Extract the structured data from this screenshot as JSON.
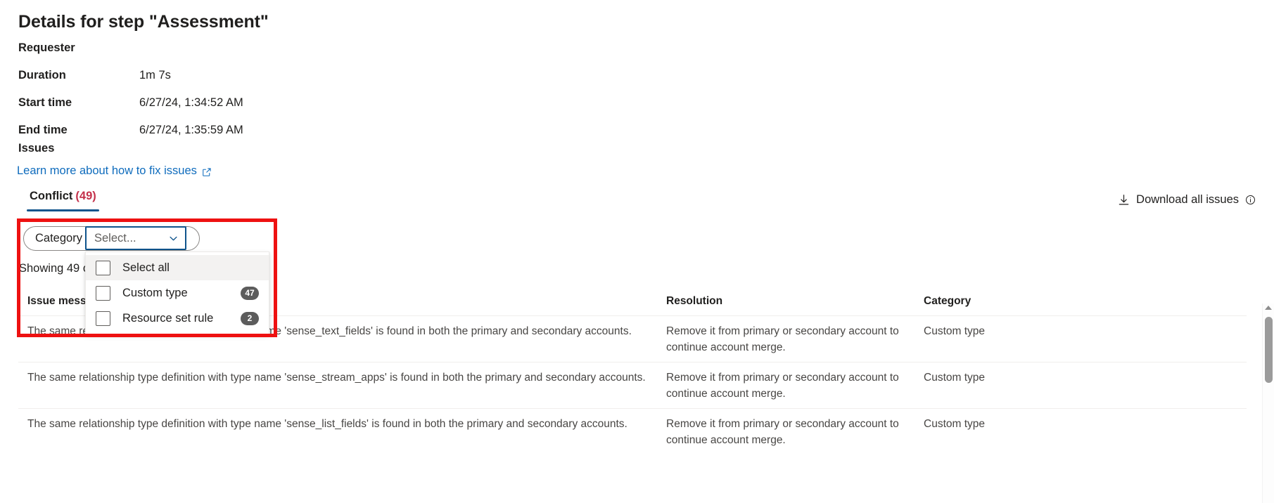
{
  "header": {
    "title": "Details for step \"Assessment\"",
    "meta": [
      {
        "label": "Requester",
        "value": ""
      },
      {
        "label": "Duration",
        "value": "1m 7s"
      },
      {
        "label": "Start time",
        "value": "6/27/24, 1:34:52 AM"
      },
      {
        "label": "End time",
        "value": "6/27/24, 1:35:59 AM"
      }
    ],
    "issues_heading": "Issues",
    "learn_link": "Learn more about how to fix issues",
    "learn_link_icon": "external-link-icon"
  },
  "tabs": [
    {
      "label": "Conflict",
      "count": "(49)",
      "selected": true
    }
  ],
  "download": {
    "label": "Download all issues",
    "download_icon": "download-icon",
    "info_icon": "info-circle-icon"
  },
  "filter": {
    "label": "Category :",
    "combo_value": "",
    "combo_placeholder": "Select...",
    "chevron_icon": "chevron-down-icon",
    "open": true,
    "options": [
      {
        "label": "Select all",
        "badge": "",
        "checked": false,
        "hovered": true
      },
      {
        "label": "Custom type",
        "badge": "47",
        "checked": false,
        "hovered": false
      },
      {
        "label": "Resource set rule",
        "badge": "2",
        "checked": false,
        "hovered": false
      }
    ]
  },
  "showing_text": "Showing 49 of",
  "table": {
    "columns": [
      {
        "key": "message",
        "label": "Issue message"
      },
      {
        "key": "resolution",
        "label": "Resolution"
      },
      {
        "key": "category",
        "label": "Category"
      }
    ],
    "rows": [
      {
        "message": "The same relationship type definition with type name 'sense_text_fields' is found in both the primary and secondary accounts.",
        "resolution": "Remove it from primary or secondary account to continue account merge.",
        "category": "Custom type"
      },
      {
        "message": "The same relationship type definition with type name 'sense_stream_apps' is found in both the primary and secondary accounts.",
        "resolution": "Remove it from primary or secondary account to continue account merge.",
        "category": "Custom type"
      },
      {
        "message": "The same relationship type definition with type name 'sense_list_fields' is found in both the primary and secondary accounts.",
        "resolution": "Remove it from primary or secondary account to continue account merge.",
        "category": "Custom type"
      }
    ]
  },
  "colors": {
    "accent": "#0f6cbd",
    "tab_underline": "#0f548c",
    "count_red": "#c4314b",
    "highlight_red": "#ee1111",
    "badge_gray": "#5c5c5c",
    "text_primary": "#201f1e",
    "text_secondary": "#484644"
  }
}
